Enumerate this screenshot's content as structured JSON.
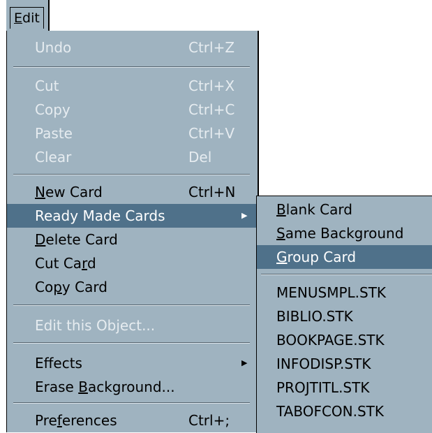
{
  "menubar": {
    "title_accel": "E",
    "title_rest": "dit"
  },
  "menu": {
    "undo": {
      "label": "Undo",
      "shortcut": "Ctrl+Z"
    },
    "cut": {
      "label": "Cut",
      "shortcut": "Ctrl+X"
    },
    "copy": {
      "label": "Copy",
      "shortcut": "Ctrl+C"
    },
    "paste": {
      "label": "Paste",
      "shortcut": "Ctrl+V"
    },
    "clear": {
      "label": "Clear",
      "shortcut": "Del"
    },
    "new_card": {
      "label_accel": "N",
      "label_rest": "ew Card",
      "shortcut": "Ctrl+N"
    },
    "ready_made_cards": {
      "label": "Ready Made Cards"
    },
    "delete_card": {
      "label_accel": "D",
      "label_rest": "elete Card"
    },
    "cut_card": {
      "label_pre": "Cut Ca",
      "label_accel": "r",
      "label_post": "d"
    },
    "copy_card": {
      "label_pre": "Co",
      "label_accel": "p",
      "label_post": "y Card"
    },
    "edit_object": {
      "label": "Edit this Object..."
    },
    "effects": {
      "label": "Effects"
    },
    "erase_background": {
      "label_pre": "Erase ",
      "label_accel": "B",
      "label_post": "ackground..."
    },
    "preferences": {
      "label_pre": "Pre",
      "label_accel": "f",
      "label_post": "erences",
      "shortcut": "Ctrl+;"
    }
  },
  "submenu": {
    "blank_card": {
      "label_accel": "B",
      "label_rest": "lank Card"
    },
    "same_background": {
      "label_accel": "S",
      "label_rest": "ame Background"
    },
    "group_card": {
      "label_accel": "G",
      "label_rest": "roup Card"
    },
    "stacks": [
      "MENUSMPL.STK",
      "BIBLIO.STK",
      "BOOKPAGE.STK",
      "INFODISP.STK",
      "PROJTITL.STK",
      "TABOFCON.STK"
    ]
  },
  "colors": {
    "menu_bg": "#9fb3c0",
    "highlight": "#4f718a",
    "disabled_text": "#e6ecf0"
  },
  "icons": {
    "submenu_arrow": "▶"
  }
}
